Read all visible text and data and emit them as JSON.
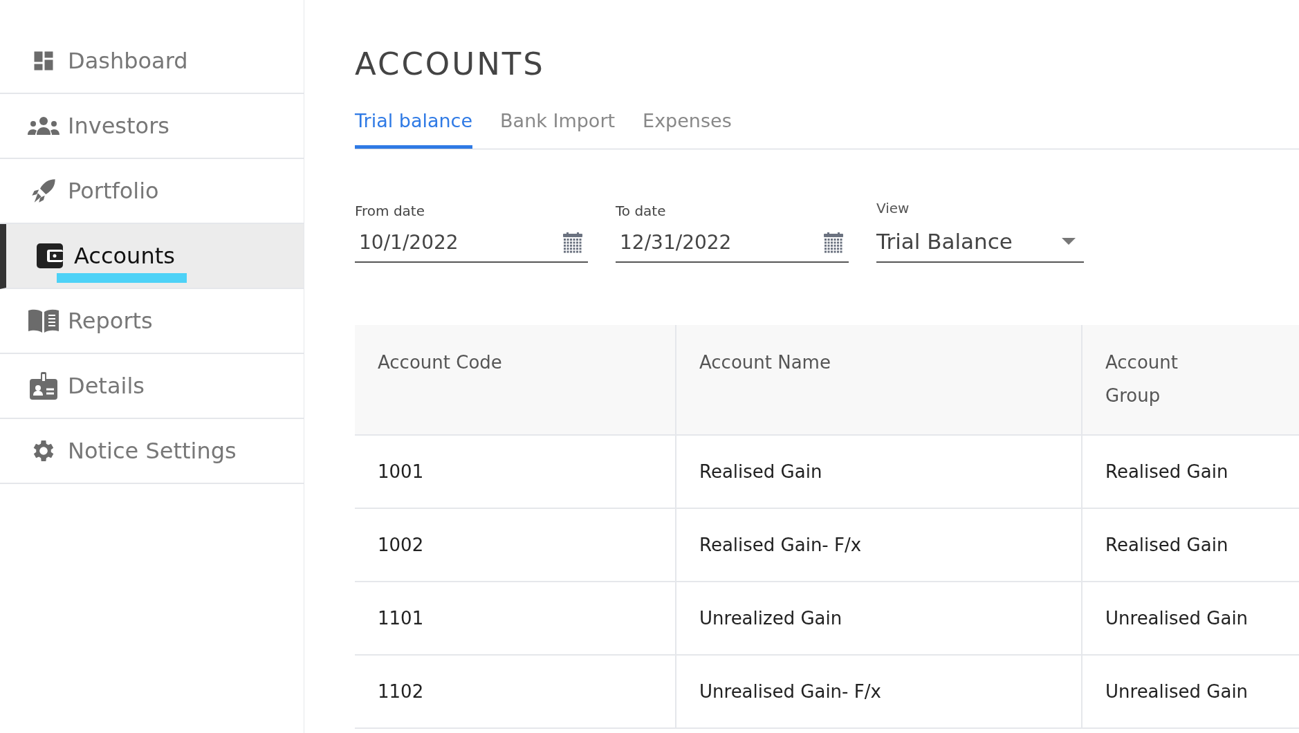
{
  "sidebar": {
    "items": [
      {
        "label": "Dashboard",
        "selected": false
      },
      {
        "label": "Investors",
        "selected": false
      },
      {
        "label": "Portfolio",
        "selected": false
      },
      {
        "label": "Accounts",
        "selected": true
      },
      {
        "label": "Reports",
        "selected": false
      },
      {
        "label": "Details",
        "selected": false
      },
      {
        "label": "Notice Settings",
        "selected": false
      }
    ]
  },
  "page_title": "ACCOUNTS",
  "tabs": [
    {
      "label": "Trial balance",
      "selected": true
    },
    {
      "label": "Bank Import",
      "selected": false
    },
    {
      "label": "Expenses",
      "selected": false
    }
  ],
  "filters": {
    "from_date": {
      "label": "From date",
      "value": "10/1/2022"
    },
    "to_date": {
      "label": "To date",
      "value": "12/31/2022"
    },
    "view": {
      "label": "View",
      "value": "Trial Balance"
    }
  },
  "table": {
    "columns": [
      "Account Code",
      "Account Name",
      "Account Group"
    ],
    "rows": [
      [
        "1001",
        "Realised Gain",
        "Realised Gain"
      ],
      [
        "1002",
        "Realised Gain- F/x",
        "Realised Gain"
      ],
      [
        "1101",
        "Unrealized Gain",
        "Unrealised Gain"
      ],
      [
        "1102",
        "Unrealised Gain- F/x",
        "Unrealised Gain"
      ]
    ]
  }
}
